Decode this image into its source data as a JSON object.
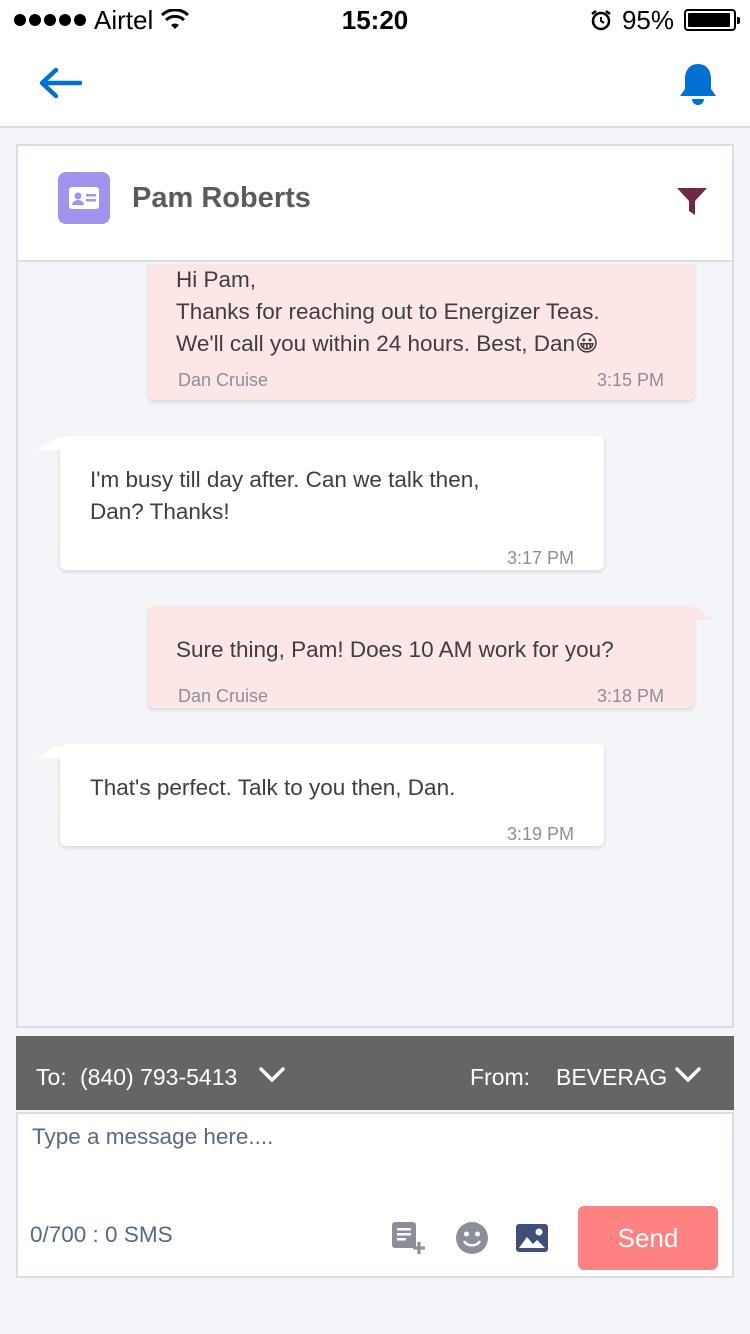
{
  "status_bar": {
    "carrier": "Airtel",
    "time": "15:20",
    "battery": "95%",
    "battery_level": 0.95
  },
  "nav": {
    "back_icon": "arrow-left-icon",
    "notification_icon": "bell-icon"
  },
  "contact": {
    "name": "Pam Roberts",
    "icon": "contact-card-icon",
    "filter_icon": "funnel-icon"
  },
  "messages": [
    {
      "direction": "outgoing",
      "lines": [
        "Hi Pam,",
        "Thanks for reaching out to Energizer Teas.",
        "We'll call you within 24 hours. Best, Dan😀"
      ],
      "sender": "Dan Cruise",
      "time": "3:15 PM"
    },
    {
      "direction": "incoming",
      "lines": [
        "I'm busy till day after. Can we talk then,",
        "Dan? Thanks!"
      ],
      "sender": "",
      "time": "3:17 PM"
    },
    {
      "direction": "outgoing",
      "lines": [
        "Sure thing, Pam! Does 10 AM work for you?"
      ],
      "sender": "Dan Cruise",
      "time": "3:18 PM"
    },
    {
      "direction": "incoming",
      "lines": [
        "That's perfect. Talk to you then, Dan."
      ],
      "sender": "",
      "time": "3:19 PM"
    }
  ],
  "composer": {
    "to_label": "To:",
    "to_number": "(840) 793-5413",
    "from_label": "From:",
    "from_value": "BEVERAGE",
    "placeholder": "Type a message here....",
    "counter": "0/700 : 0 SMS",
    "send_label": "Send",
    "colors": {
      "send": "#ff8282",
      "bar": "#666566",
      "outgoing": "#fde6e6"
    }
  }
}
